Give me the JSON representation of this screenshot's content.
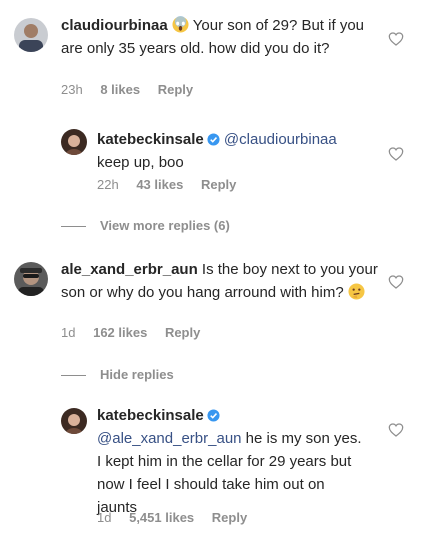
{
  "colors": {
    "text": "#262626",
    "muted": "#8e8e8e",
    "mention": "#385185",
    "verified": "#3897f0"
  },
  "comments": [
    {
      "username": "claudiourbinaa",
      "emoji": "face-screaming-in-fear",
      "text": "Your son of 29? But if you are only 35 years old. how did you do it?",
      "time": "23h",
      "likes": "8 likes",
      "reply": "Reply"
    },
    {
      "username": "katebeckinsale",
      "verified": true,
      "mention": "@claudiourbinaa",
      "text": "keep up, boo",
      "time": "22h",
      "likes": "43 likes",
      "reply": "Reply"
    },
    {
      "username": "ale_xand_erbr_aun",
      "text": "Is the boy next to you your son or why do you hang arround with him?",
      "emoji": "thinking-face",
      "time": "1d",
      "likes": "162 likes",
      "reply": "Reply"
    },
    {
      "username": "katebeckinsale",
      "verified": true,
      "mention": "@ale_xand_erbr_aun",
      "text": "he is my son yes. I kept him in the cellar for 29 years but now I feel I should take him out on jaunts",
      "time": "1d",
      "likes": "5,451 likes",
      "reply": "Reply"
    }
  ],
  "toggles": {
    "view_more": "View more replies (6)",
    "hide": "Hide replies"
  },
  "icons": {
    "like": "heart-outline-icon",
    "verified": "verified-badge-icon"
  }
}
